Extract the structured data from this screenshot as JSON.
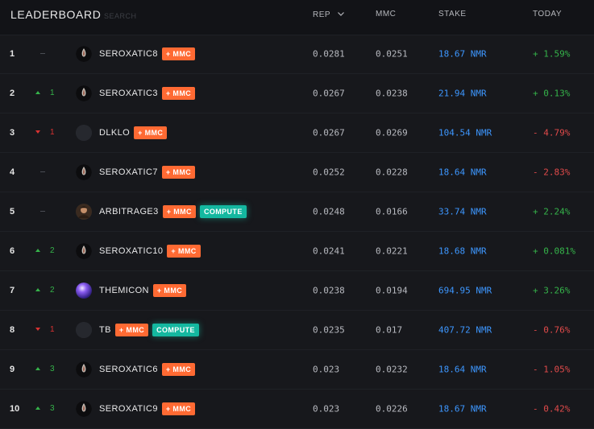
{
  "header": {
    "title": "LEADERBOARD",
    "search_placeholder": "SEARCH",
    "columns": {
      "rep": "REP",
      "mmc": "MMC",
      "stake": "STAKE",
      "today": "TODAY"
    }
  },
  "colors": {
    "mmc_badge": "#ff6a33",
    "compute_badge": "#14b8a0",
    "stake_blue": "#3d97ff",
    "positive_green": "#35b34a",
    "negative_red": "#e04a4a"
  },
  "rows": [
    {
      "rank": "1",
      "delta_dir": "none",
      "delta": "",
      "avatar": "flame-avatar",
      "name": "SEROXATIC8",
      "mmc_badge": "+ MMC",
      "compute_badge": "",
      "rep": "0.0281",
      "mmc": "0.0251",
      "stake": "18.67 NMR",
      "today": "+ 1.59%",
      "today_sign": "pos"
    },
    {
      "rank": "2",
      "delta_dir": "up",
      "delta": "1",
      "avatar": "flame-avatar",
      "name": "SEROXATIC3",
      "mmc_badge": "+ MMC",
      "compute_badge": "",
      "rep": "0.0267",
      "mmc": "0.0238",
      "stake": "21.94 NMR",
      "today": "+ 0.13%",
      "today_sign": "pos"
    },
    {
      "rank": "3",
      "delta_dir": "down",
      "delta": "1",
      "avatar": "blank-avatar",
      "name": "DLKLO",
      "mmc_badge": "+ MMC",
      "compute_badge": "",
      "rep": "0.0267",
      "mmc": "0.0269",
      "stake": "104.54 NMR",
      "today": "- 4.79%",
      "today_sign": "neg"
    },
    {
      "rank": "4",
      "delta_dir": "none",
      "delta": "",
      "avatar": "flame-avatar",
      "name": "SEROXATIC7",
      "mmc_badge": "+ MMC",
      "compute_badge": "",
      "rep": "0.0252",
      "mmc": "0.0228",
      "stake": "18.64 NMR",
      "today": "- 2.83%",
      "today_sign": "neg"
    },
    {
      "rank": "5",
      "delta_dir": "none",
      "delta": "",
      "avatar": "photo-avatar",
      "name": "ARBITRAGE3",
      "mmc_badge": "+ MMC",
      "compute_badge": "COMPUTE",
      "rep": "0.0248",
      "mmc": "0.0166",
      "stake": "33.74 NMR",
      "today": "+ 2.24%",
      "today_sign": "pos"
    },
    {
      "rank": "6",
      "delta_dir": "up",
      "delta": "2",
      "avatar": "flame-avatar",
      "name": "SEROXATIC10",
      "mmc_badge": "+ MMC",
      "compute_badge": "",
      "rep": "0.0241",
      "mmc": "0.0221",
      "stake": "18.68 NMR",
      "today": "+ 0.081%",
      "today_sign": "pos"
    },
    {
      "rank": "7",
      "delta_dir": "up",
      "delta": "2",
      "avatar": "orb-avatar",
      "name": "THEMICON",
      "mmc_badge": "+ MMC",
      "compute_badge": "",
      "rep": "0.0238",
      "mmc": "0.0194",
      "stake": "694.95 NMR",
      "today": "+ 3.26%",
      "today_sign": "pos"
    },
    {
      "rank": "8",
      "delta_dir": "down",
      "delta": "1",
      "avatar": "blank-avatar",
      "name": "TB",
      "mmc_badge": "+ MMC",
      "compute_badge": "COMPUTE",
      "rep": "0.0235",
      "mmc": "0.017",
      "stake": "407.72 NMR",
      "today": "- 0.76%",
      "today_sign": "neg"
    },
    {
      "rank": "9",
      "delta_dir": "up",
      "delta": "3",
      "avatar": "flame-avatar",
      "name": "SEROXATIC6",
      "mmc_badge": "+ MMC",
      "compute_badge": "",
      "rep": "0.023",
      "mmc": "0.0232",
      "stake": "18.64 NMR",
      "today": "- 1.05%",
      "today_sign": "neg"
    },
    {
      "rank": "10",
      "delta_dir": "up",
      "delta": "3",
      "avatar": "flame-avatar",
      "name": "SEROXATIC9",
      "mmc_badge": "+ MMC",
      "compute_badge": "",
      "rep": "0.023",
      "mmc": "0.0226",
      "stake": "18.67 NMR",
      "today": "- 0.42%",
      "today_sign": "neg"
    }
  ]
}
